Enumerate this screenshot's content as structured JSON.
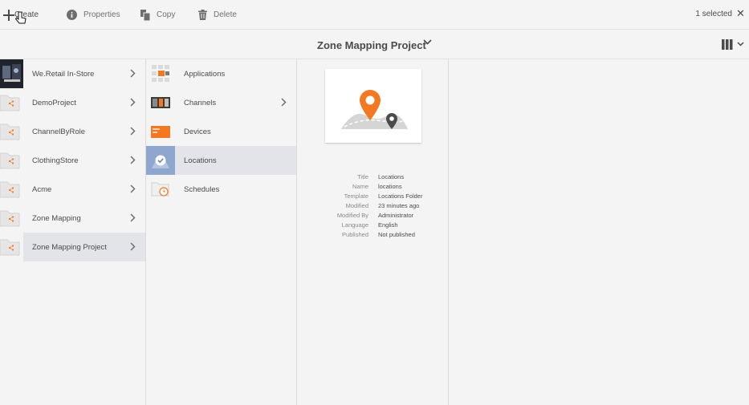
{
  "toolbar": {
    "create_label": "Create",
    "properties_label": "Properties",
    "copy_label": "Copy",
    "delete_label": "Delete",
    "selected_label": "1 selected"
  },
  "title": {
    "text": "Zone Mapping Project"
  },
  "column1": {
    "items": [
      {
        "label": "We.Retail In-Store"
      },
      {
        "label": "DemoProject"
      },
      {
        "label": "ChannelByRole"
      },
      {
        "label": "ClothingStore"
      },
      {
        "label": "Acme"
      },
      {
        "label": "Zone Mapping"
      },
      {
        "label": "Zone Mapping Project"
      }
    ]
  },
  "column2": {
    "items": [
      {
        "label": "Applications"
      },
      {
        "label": "Channels"
      },
      {
        "label": "Devices"
      },
      {
        "label": "Locations"
      },
      {
        "label": "Schedules"
      }
    ]
  },
  "details": {
    "rows": [
      {
        "key": "Title",
        "value": "Locations"
      },
      {
        "key": "Name",
        "value": "locations"
      },
      {
        "key": "Template",
        "value": "Locations Folder"
      },
      {
        "key": "Modified",
        "value": "23 minutes ago"
      },
      {
        "key": "Modified By",
        "value": "Administrator"
      },
      {
        "key": "Language",
        "value": "English"
      },
      {
        "key": "Published",
        "value": "Not published"
      }
    ]
  },
  "colors": {
    "accent": "#f47721",
    "selected_bg": "#e2e4e9"
  }
}
